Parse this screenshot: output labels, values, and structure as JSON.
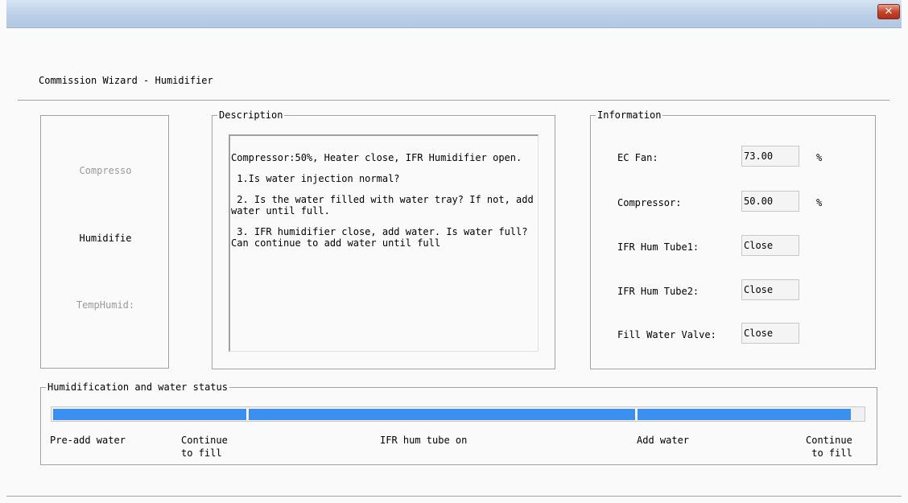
{
  "window": {
    "close_glyph": "✕"
  },
  "wizard": {
    "title": "Commission Wizard - Humidifier"
  },
  "steps": [
    {
      "label": "Compresso",
      "state": "done"
    },
    {
      "label": "Humidifie",
      "state": "current"
    },
    {
      "label": "TempHumid:",
      "state": "pending"
    }
  ],
  "description": {
    "legend": "Description",
    "paragraphs": [
      "Compressor:50%, Heater close, IFR Humidifier open.",
      " 1.Is water injection normal?",
      " 2. Is the water filled with water tray? If not, add water until full.",
      " 3. IFR humidifier close, add water. Is water full?Can continue to add water until full"
    ]
  },
  "information": {
    "legend": "Information",
    "rows": [
      {
        "label": "EC Fan:",
        "value": "73.00",
        "unit": "%"
      },
      {
        "label": "Compressor:",
        "value": "50.00",
        "unit": "%"
      },
      {
        "label": "IFR Hum Tube1:",
        "value": "Close",
        "unit": ""
      },
      {
        "label": "IFR Hum Tube2:",
        "value": "Close",
        "unit": ""
      },
      {
        "label": "Fill Water Valve:",
        "value": "Close",
        "unit": ""
      }
    ]
  },
  "status": {
    "legend": "Humidification and water status",
    "progress_color": "#3b8ff0",
    "progress_fraction": 0.985,
    "stages": [
      {
        "label": "Pre-add water"
      },
      {
        "label": "Continue\nto fill"
      },
      {
        "label": "IFR hum tube on"
      },
      {
        "label": "Add water"
      },
      {
        "label": "Continue\nto fill"
      }
    ]
  }
}
